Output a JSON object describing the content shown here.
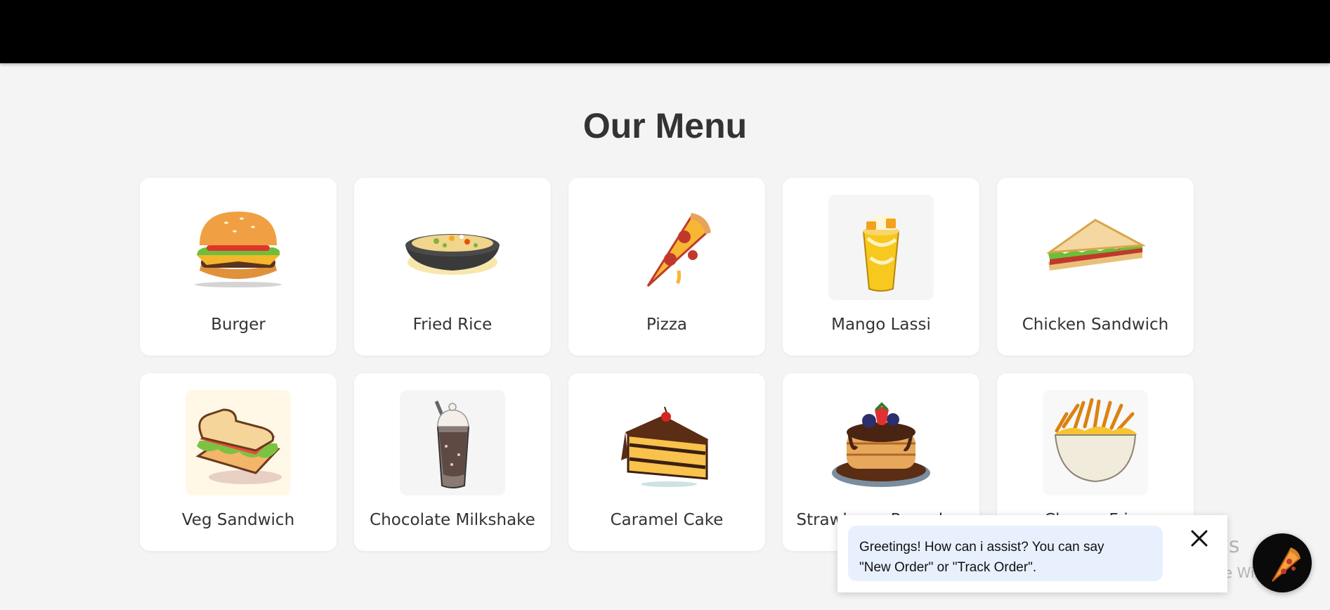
{
  "header": {
    "background": "#000000"
  },
  "menu": {
    "title": "Our Menu",
    "items": [
      {
        "name": "Burger",
        "icon": "burger-icon"
      },
      {
        "name": "Fried Rice",
        "icon": "fried-rice-icon"
      },
      {
        "name": "Pizza",
        "icon": "pizza-slice-icon"
      },
      {
        "name": "Mango Lassi",
        "icon": "mango-lassi-icon"
      },
      {
        "name": "Chicken Sandwich",
        "icon": "chicken-sandwich-icon"
      },
      {
        "name": "Veg Sandwich",
        "icon": "veg-sandwich-icon"
      },
      {
        "name": "Chocolate Milkshake",
        "icon": "chocolate-milkshake-icon"
      },
      {
        "name": "Caramel Cake",
        "icon": "caramel-cake-icon"
      },
      {
        "name": "Strawberry Pancakes",
        "icon": "strawberry-pancakes-icon"
      },
      {
        "name": "Cheese Fries",
        "icon": "cheese-fries-icon"
      }
    ]
  },
  "chatbot": {
    "message_line1": "Greetings! How can i assist? You can say",
    "message_line2": "\"New Order\" or \"Track Order\".",
    "close_icon": "close-icon",
    "launcher_icon": "pizza-slice-icon",
    "bubble_color": "#e8f0fd"
  },
  "watermark": {
    "title": "Activate Windows",
    "subtitle": "Go to Settings to activate Windows."
  }
}
